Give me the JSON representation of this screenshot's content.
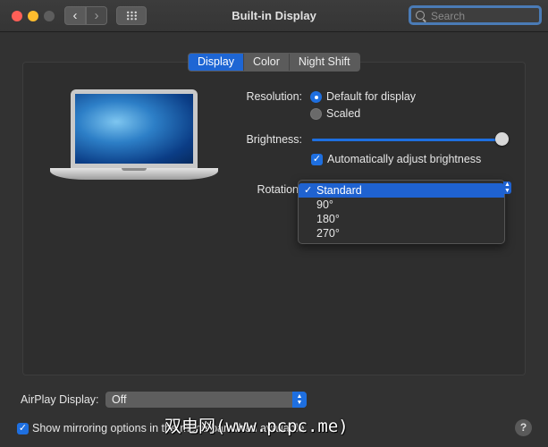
{
  "window": {
    "title": "Built-in Display",
    "search_placeholder": "Search",
    "back_glyph": "‹",
    "forward_glyph": "›"
  },
  "tabs": [
    {
      "label": "Display",
      "active": true
    },
    {
      "label": "Color",
      "active": false
    },
    {
      "label": "Night Shift",
      "active": false
    }
  ],
  "resolution": {
    "label": "Resolution:",
    "options": [
      {
        "label": "Default for display",
        "selected": true
      },
      {
        "label": "Scaled",
        "selected": false
      }
    ]
  },
  "brightness": {
    "label": "Brightness:",
    "level": 0.99,
    "auto_label": "Automatically adjust brightness",
    "auto_checked": true
  },
  "rotation": {
    "label": "Rotation",
    "check_glyph": "✓",
    "options": [
      "Standard",
      "90°",
      "180°",
      "270°"
    ],
    "selected": "Standard"
  },
  "airplay": {
    "label": "AirPlay Display:",
    "value": "Off"
  },
  "mirroring": {
    "label": "Show mirroring options in the menu bar when available",
    "checked": true
  },
  "help_glyph": "?",
  "watermark": "双电网(www.pcpc.me)",
  "colors": {
    "accent": "#1e6fe0",
    "window_bg": "#323232",
    "close": "#fe5f57",
    "minimize": "#febc2e"
  },
  "icons": [
    "close-icon",
    "minimize-icon",
    "zoom-icon",
    "chevron-left-icon",
    "chevron-right-icon",
    "grid-icon",
    "search-icon",
    "laptop-icon",
    "checkmark-icon",
    "help-icon"
  ]
}
